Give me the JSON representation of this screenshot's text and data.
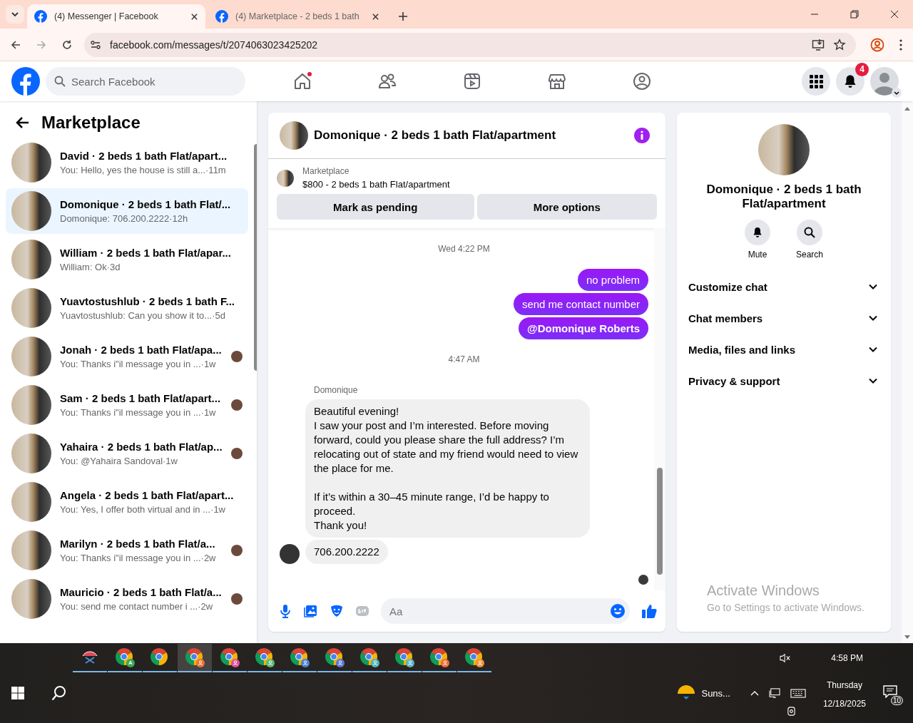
{
  "browser": {
    "tabs": [
      {
        "title": "(4) Messenger | Facebook",
        "selected": true
      },
      {
        "title": "(4) Marketplace - 2 beds 1 bath",
        "selected": false
      }
    ],
    "url": "facebook.com/messages/t/2074063023425202"
  },
  "header": {
    "search_placeholder": "Search Facebook",
    "nav": [
      {
        "kind": "home",
        "dot": true
      },
      {
        "kind": "friends",
        "dot": false
      },
      {
        "kind": "video",
        "dot": false
      },
      {
        "kind": "marketplace",
        "dot": false
      },
      {
        "kind": "groups",
        "dot": false
      }
    ],
    "notifications": "4"
  },
  "sidebar": {
    "title": "Marketplace",
    "conversations": [
      {
        "name": "David · 2 beds 1 bath Flat/apart...",
        "preview": "You: Hello, yes the house is still a...",
        "time": "·11m",
        "selected": false,
        "seen": false
      },
      {
        "name": "Domonique · 2 beds 1 bath Flat/...",
        "preview": "Domonique: 706.200.2222",
        "time": "·12h",
        "selected": true,
        "seen": false
      },
      {
        "name": "William · 2 beds 1 bath Flat/apar...",
        "preview": "William: Ok",
        "time": "·3d",
        "selected": false,
        "seen": false
      },
      {
        "name": "Yuavtostushlub · 2 beds 1 bath F...",
        "preview": "Yuavtostushlub: Can you show it to...",
        "time": "·5d",
        "selected": false,
        "seen": false
      },
      {
        "name": "Jonah · 2 beds 1 bath Flat/apa...",
        "preview": "You: Thanks i\"il message you in ...",
        "time": "·1w",
        "selected": false,
        "seen": true
      },
      {
        "name": "Sam · 2 beds 1 bath Flat/apart...",
        "preview": "You: Thanks i\"il message you in ...",
        "time": "·1w",
        "selected": false,
        "seen": true
      },
      {
        "name": "Yahaira · 2 beds 1 bath Flat/ap...",
        "preview": "You: @Yahaira Sandoval",
        "time": "·1w",
        "selected": false,
        "seen": true
      },
      {
        "name": "Angela · 2 beds 1 bath Flat/apart...",
        "preview": "You: Yes, I offer both virtual and in ...",
        "time": "·1w",
        "selected": false,
        "seen": false
      },
      {
        "name": "Marilyn · 2 beds 1 bath Flat/a...",
        "preview": "You: Thanks i\"il message you in ...",
        "time": "·2w",
        "selected": false,
        "seen": true
      },
      {
        "name": "Mauricio · 2 beds 1 bath Flat/a...",
        "preview": "You: send me contact number i ...",
        "time": "·2w",
        "selected": false,
        "seen": true
      }
    ]
  },
  "chat": {
    "title": "Domonique · 2 beds 1 bath Flat/apartment",
    "listing": {
      "label": "Marketplace",
      "text": "$800 - 2 beds 1 bath Flat/apartment"
    },
    "buttons": [
      "Mark as pending",
      "More options"
    ],
    "messages": [
      {
        "kind": "timestamp",
        "text": "Wed 4:22 PM"
      },
      {
        "kind": "outgoing",
        "text": "no problem",
        "mention": false
      },
      {
        "kind": "outgoing",
        "text": "send me contact number",
        "mention": false
      },
      {
        "kind": "outgoing",
        "text": "@Domonique Roberts",
        "mention": true
      },
      {
        "kind": "timestamp",
        "text": "4:47 AM"
      },
      {
        "kind": "incoming",
        "sender": "Domonique",
        "text": "Beautiful evening!\nI saw your post and I’m interested. Before moving forward, could you please share the full address? I’m relocating out of state and my friend would need to view the place for me.\n\nIf it’s within a 30–45 minute range, I’d be happy to proceed.\nThank you!",
        "avatar": false
      },
      {
        "kind": "incoming",
        "text": "706.200.2222",
        "avatar": true
      }
    ],
    "seen": true,
    "composer_placeholder": "Aa"
  },
  "details": {
    "title": "Domonique · 2 beds 1 bath Flat/apartment",
    "actions": [
      {
        "kind": "mute",
        "label": "Mute"
      },
      {
        "kind": "search",
        "label": "Search"
      }
    ],
    "sections": [
      "Customize chat",
      "Chat members",
      "Media, files and links",
      "Privacy & support"
    ]
  },
  "activation_notice": {
    "title": "Activate Windows",
    "text": "Go to Settings to activate Windows."
  },
  "taskbar": {
    "apps": [
      {
        "kind": "snipping",
        "selected": false
      },
      {
        "kind": "chrome",
        "badge": "A",
        "color": "#34a853",
        "selected": false
      },
      {
        "kind": "chrome",
        "selected": false
      },
      {
        "kind": "chrome",
        "color": "#e8713a",
        "selected": true
      },
      {
        "kind": "chrome",
        "color": "#e0509c",
        "selected": false
      },
      {
        "kind": "chrome",
        "color": "#5bb974",
        "selected": false
      },
      {
        "kind": "chrome",
        "color": "#4a7fd6",
        "selected": false
      },
      {
        "kind": "chrome",
        "color": "#5b77d9",
        "selected": false
      },
      {
        "kind": "chrome",
        "color": "#4fb3bf",
        "selected": false
      },
      {
        "kind": "chrome",
        "color": "#5ab4c4",
        "selected": false
      },
      {
        "kind": "chrome",
        "color": "#ee6c3a",
        "selected": false
      },
      {
        "kind": "chrome",
        "color": "#f0903a",
        "selected": false
      }
    ],
    "weather": "Suns...",
    "time": "4:58 PM",
    "day": "Thursday",
    "date": "12/18/2025",
    "notifications": "10"
  }
}
